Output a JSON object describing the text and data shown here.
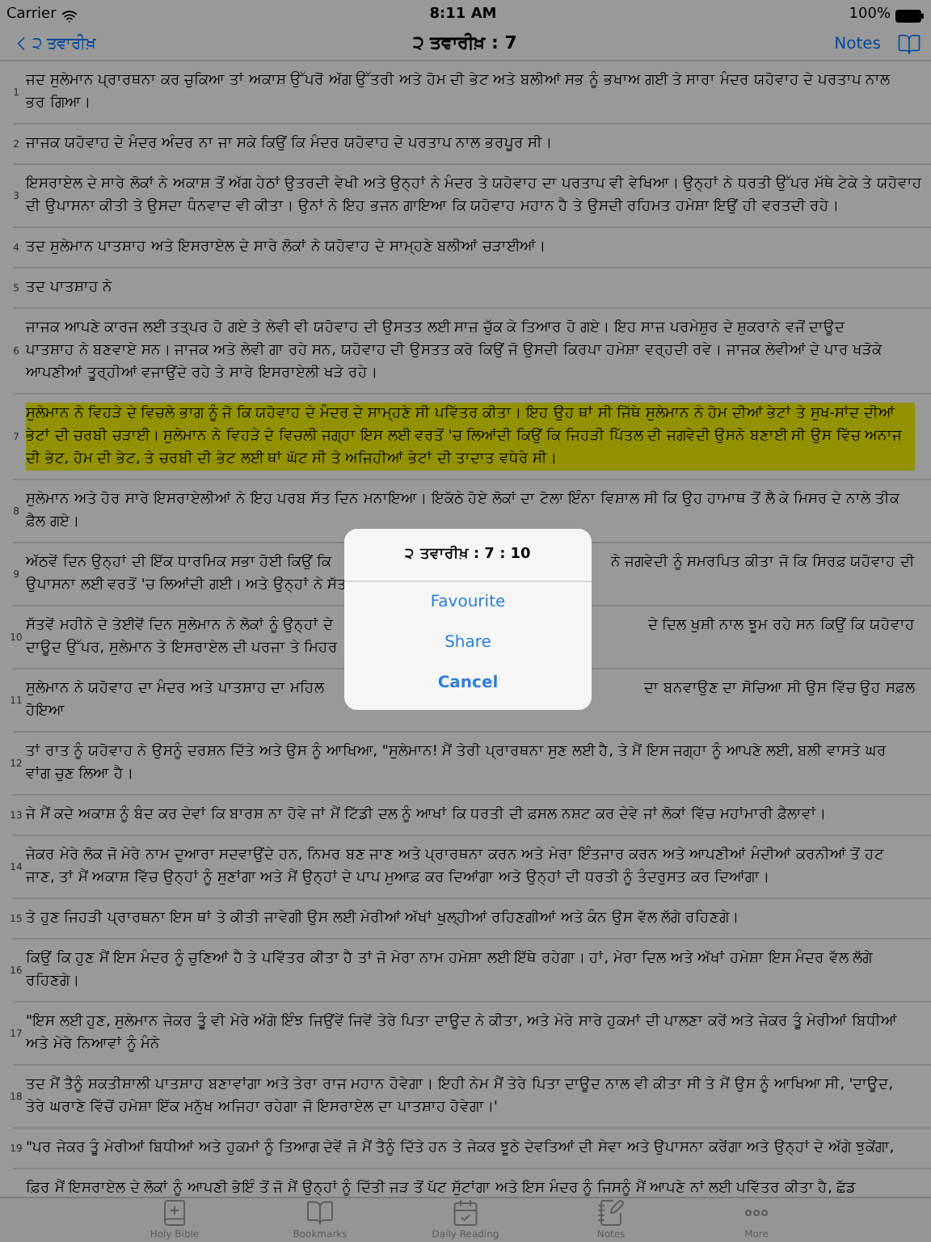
{
  "status_bar": {
    "carrier": "Carrier",
    "time": "8:11 AM",
    "battery": "100%"
  },
  "nav": {
    "back": "੨ ਤਵਾਰੀਖ਼",
    "title": "੨ ਤਵਾਰੀਖ਼ : 7",
    "notes": "Notes"
  },
  "verses": [
    {
      "number": "1",
      "highlighted": false,
      "lines": [
        [
          "ਜਦ ਸੁਲੇਮਾਨ ਪ੍ਰਾਰਥਨਾ ਕਰ ਚੁਕਿਆ ਤਾਂ ਅਕਾਸ਼ ਉੱਪਰੋਂ ਅੱਗ ਉੱਤਰੀ ਅਤੇ ਹੋਮ ਦੀ ਭੇਟ ਅਤੇ ਬਲੀਆਂ ਸਭ ਨੂੰ ਭਖਾਅ ਗਈ ਤੇ ਸਾਰਾ ਮੰਦਰ ਯਹੋਵਾਹ ਦੇ ਪਰਤਾਪ ਨਾਲ"
        ],
        [
          "ਭਰ ਗਿਆ।"
        ]
      ]
    },
    {
      "number": "2",
      "highlighted": false,
      "lines": [
        [
          "ਜਾਜਕ ਯਹੋਵਾਹ ਦੇ ਮੰਦਰ ਅੰਦਰ ਨਾ ਜਾ ਸਕੇ ਕਿਉਂ ਕਿ ਮੰਦਰ ਯਹੋਵਾਹ ਦੇ ਪਰਤਾਪ ਨਾਲ ਭਰਪੂਰ ਸੀ।"
        ]
      ]
    },
    {
      "number": "3",
      "highlighted": false,
      "lines": [
        [
          "ਇਸਰਾਏਲ ਦੇ ਸਾਰੇ ਲੋਕਾਂ ਨੇ ਅਕਾਸ਼ ਤੋਂ ਅੱਗ ਹੇਠਾਂ ਉਤਰਦੀ ਵੇਖੀ ਅਤੇ ਉਨ੍ਹਾਂ ਨੇ ਮੰਦਰ ਤੇ ਯਹੋਵਾਹ ਦਾ ਪਰਤਾਪ ਵੀ ਵੇਖਿਆ। ਉਨ੍ਹਾਂ ਨੇ ਧਰਤੀ ਉੱਪਰ ਮੱਥੇ ਟੇਕੇ ਤੇ ਯਹੋਵਾਹ"
        ],
        [
          "ਦੀ ਉਪਾਸਨਾ ਕੀਤੀ ਤੇ ਉਸਦਾ ਧੰਨਵਾਦ ਵੀ ਕੀਤਾ। ਉਨਾਂ ਨੇ ਇਹ ਭਜਨ ਗਾਇਆ ਕਿ ਯਹੋਵਾਹ ਮਹਾਨ ਹੈ ਤੇ ਉਸਦੀ ਰਹਿਮਤ ਹਮੇਸ਼ਾ ਇਉਂ ਹੀ ਵਰਤਦੀ ਰਹੇ।"
        ]
      ]
    },
    {
      "number": "4",
      "highlighted": false,
      "lines": [
        [
          "ਤਦ ਸੁਲੇਮਾਨ ਪਾਤਸ਼ਾਹ ਅਤੇ ਇਸਰਾਏਲ ਦੇ ਸਾਰੇ ਲੋਕਾਂ ਨੇ ਯਹੋਵਾਹ ਦੇ ਸਾਮ੍ਹਣੇ ਬਲੀਆਂ ਚੜਾਈਆਂ।"
        ]
      ]
    },
    {
      "number": "5",
      "highlighted": false,
      "lines": [
        [
          "ਤਦ ਪਾਤਸ਼ਾਹ ਨੇ"
        ]
      ]
    },
    {
      "number": "6",
      "highlighted": false,
      "lines": [
        [
          "ਜਾਜਕ ਆਪਣੇ ਕਾਰਜ ਲਈ ਤਤ੍ਪਰ ਹੋ ਗਏ ਤੇ ਲੇਵੀ ਵੀ ਯਹੋਵਾਹ ਦੀ ਉਸਤਤ ਲਈ ਸਾਜ਼ ਚੁੱਕ ਕੇ ਤਿਆਰ ਹੋ ਗਏ। ਇਹ ਸਾਜ਼ ਪਰਮੇਸ਼ੁਰ ਦੇ ਸ਼ੁਕਰਾਨੇ ਵਜੋਂ ਦਾਊਦ"
        ],
        [
          "ਪਾਤਸ਼ਾਹ ਨੇ ਬਣਵਾਏ ਸਨ। ਜਾਜਕ ਅਤੇ ਲੇਵੀ ਗਾ ਰਹੇ ਸਨ, ਯਹੋਵਾਹ ਦੀ ਉਸਤਤ ਕਰੋ ਕਿਉਂ ਜੋ ਉਸਦੀ ਕਿਰਪਾ ਹਮੇਸ਼ਾ ਵਰ੍ਹਦੀ ਰਵੇ। ਜਾਜਕ ਲੇਵੀਆਂ ਦੇ ਪਾਰ ਖੜੋਕੇ"
        ],
        [
          "ਆਪਣੀਆਂ ਤੂਰ੍ਹੀਆਂ ਵਜਾਉਂਦੇ ਰਹੇ ਤੇ ਸਾਰੇ ਇਸਰਾਏਲੀ ਖੜੇ ਰਹੇ।"
        ]
      ]
    },
    {
      "number": "7",
      "highlighted": true,
      "lines": [
        [
          "ਸੁਲੇਮਾਨ ਨੇ ਵਿਹੜੇ ਦੇ ਵਿਚਲੇ ਭਾਗ ਨੂੰ ਜੋ ਕਿ ਯਹੋਵਾਹ ਦੇ ਮੰਦਰ ਦੇ ਸਾਮ੍ਹਣੇ ਸੀ ਪਵਿੱਤਰ ਕੀਤਾ। ਇਹ ਉਹ ਥਾਂ ਸੀ ਜਿੱਥੇ ਸੁਲੇਮਾਨ ਨੇ ਹੋਮ ਦੀਆਂ ਭੇਟਾਂ ਤੇ ਸੁਖ-ਸਾਂਦ ਦੀਆਂ"
        ],
        [
          "ਭੇਟਾਂ ਦੀ ਚਰਬੀ ਚੜਾਈ। ਸੁਲੇਮਾਨ ਨੇ ਵਿਹੜੇ ਦੇ ਵਿਚਲੀ ਜਗ੍ਹਾ ਇਸ ਲਈ ਵਰਤੋਂ 'ਚ ਲਿਆਂਦੀ ਕਿਉਂ ਕਿ ਜਿਹੜੀ ਪਿੱਤਲ ਦੀ ਜਗਵੇਦੀ ਉਸਨੇ ਬਣਾਈ ਸੀ ਉਸ ਵਿੱਚ ਅਨਾਜ"
        ],
        [
          "ਦੀ ਭੇਟ, ਹੋਮ ਦੀ ਭੇਟ, ਤੇ ਚਰਬੀ ਦੀ ਭੇਟ ਲਈ ਥਾਂ ਘੱਟ ਸੀ ਤੇ ਅਜਿਹੀਆਂ ਭੇਟਾਂ ਦੀ ਤਾਦਾਤ ਵਧੇਰੇ ਸੀ।"
        ]
      ]
    },
    {
      "number": "8",
      "highlighted": false,
      "lines": [
        [
          "ਸੁਲੇਮਾਨ ਅਤੇ ਹੋਰ ਸਾਰੇ ਇਸਰਾਏਲੀਆਂ ਨੇ ਇਹ ਪਰਬ ਸੱਤ ਦਿਨ ਮਨਾਇਆ। ਇਕੱਠੇ ਹੋਏ ਲੋਕਾਂ ਦਾ ਟੋਲਾ ਇੰਨਾ ਵਿਸ਼ਾਲ ਸੀ ਕਿ ਉਹ ਹਾਮਾਥ ਤੋਂ ਲੈ ਕੇ ਮਿਸਰ ਦੇ ਨਾਲੇ ਤੀਕ"
        ],
        [
          "ਫ਼ੈਲ ਗਏ।"
        ]
      ]
    },
    {
      "number": "9",
      "highlighted": false,
      "lines": [
        [
          "ਅੱਠਵੇਂ ਦਿਨ ਉਨ੍ਹਾਂ ਦੀ ਇੱਕ ਧਾਰਮਿਕ ਸਭਾ ਹੋਈ ਕਿਉਂ ਕਿ",
          "ਨੇ ਜਗਵੇਦੀ ਨੂੰ ਸਮਰਪਿਤ ਕੀਤਾ ਜੋ ਕਿ ਸਿਰਫ਼ ਯਹੋਵਾਹ ਦੀ"
        ],
        [
          "ਉਪਾਸਨਾ ਲਈ ਵਰਤੋਂ 'ਚ ਲਿਆਂਦੀ ਗਈ। ਅਤੇ ਉਨ੍ਹਾਂ ਨੇ ਸੱਤ"
        ]
      ]
    },
    {
      "number": "10",
      "highlighted": false,
      "lines": [
        [
          "ਸੱਤਵੇਂ ਮਹੀਨੇ ਦੇ ਤੇਈਵੇਂ ਦਿਨ ਸੁਲੇਮਾਨ ਨੇ ਲੋਕਾਂ ਨੂੰ ਉਨ੍ਹਾਂ ਦੇ",
          "ਦੇ ਦਿਲ ਖੁਸ਼ੀ ਨਾਲ ਝੂਮ ਰਹੇ ਸਨ ਕਿਉਂ ਕਿ ਯਹੋਵਾਹ"
        ],
        [
          "ਦਾਊਦ ਉੱਪਰ, ਸੁਲੇਮਾਨ ਤੇ ਇਸਰਾਏਲ ਦੀ ਪਰਜਾ ਤੇ ਮਿਹਰ"
        ]
      ]
    },
    {
      "number": "11",
      "highlighted": false,
      "lines": [
        [
          "ਸੁਲੇਮਾਨ ਨੇ ਯਹੋਵਾਹ ਦਾ ਮੰਦਰ ਅਤੇ ਪਾਤਸ਼ਾਹ ਦਾ ਮਹਿਲ",
          "ਦਾ ਬਨਵਾਉਣ ਦਾ ਸੋਚਿਆ ਸੀ ਉਸ ਵਿੱਚ ਉਹ ਸਫ਼ਲ"
        ],
        [
          "ਹੋਇਆ"
        ]
      ]
    },
    {
      "number": "12",
      "highlighted": false,
      "lines": [
        [
          "ਤਾਂ ਰਾਤ ਨੂੰ ਯਹੋਵਾਹ ਨੇ ਉਸਨੂੰ ਦਰਸ਼ਨ ਦਿੱਤੇ ਅਤੇ ਉਸ ਨੂੰ ਆਖਿਆ, \"ਸੁਲੇਮਾਨ! ਮੈਂ ਤੇਰੀ ਪ੍ਰਾਰਥਨਾ ਸੁਣ ਲਈ ਹੈ, ਤੇ ਮੈਂ ਇਸ ਜਗ੍ਹਾ ਨੂੰ ਆਪਣੇ ਲਈ, ਬਲੀ ਵਾਸਤੇ ਘਰ"
        ],
        [
          "ਵਾਂਗ ਚੁਣ ਲਿਆ ਹੈ।"
        ]
      ]
    },
    {
      "number": "13",
      "highlighted": false,
      "lines": [
        [
          "ਜੇ ਮੈਂ ਕਦੇ ਅਕਾਸ਼ ਨੂੰ ਬੰਦ ਕਰ ਦੇਵਾਂ ਕਿ ਬਾਰਸ਼ ਨਾ ਹੋਵੇ ਜਾਂ ਮੈਂ ਟਿੱਡੀ ਦਲ ਨੂੰ ਆਖਾਂ ਕਿ ਧਰਤੀ ਦੀ ਫ਼ਸਲ ਨਸ਼ਟ ਕਰ ਦੇਵੇ ਜਾਂ ਲੋਕਾਂ ਵਿੱਚ ਮਹਾਂਮਾਰੀ ਫ਼ੈਲਾਵਾਂ।"
        ]
      ]
    },
    {
      "number": "14",
      "highlighted": false,
      "lines": [
        [
          "ਜੇਕਰ ਮੇਰੇ ਲੋਕ ਜੋ ਮੇਰੇ ਨਾਮ ਦੁਆਰਾ ਸਦਵਾਉਂਦੇ ਹਨ, ਨਿਮਰ ਬਣ ਜਾਣ ਅਤੇ ਪ੍ਰਾਰਥਨਾ ਕਰਨ ਅਤੇ ਮੇਰਾ ਇੰਤਜਾਰ ਕਰਨ ਅਤੇ ਆਪਣੀਆਂ ਮੰਦੀਆਂ ਕਰਨੀਆਂ ਤੋਂ ਹਟ"
        ],
        [
          "ਜਾਣ, ਤਾਂ ਮੈਂ ਅਕਾਸ਼ ਵਿੱਚ ਉਨ੍ਹਾਂ ਨੂੰ ਸੁਣਾਂਗਾ ਅਤੇ ਮੈਂ ਉਨ੍ਹਾਂ ਦੇ ਪਾਪ ਮੁਆਫ਼ ਕਰ ਦਿਆਂਗਾ ਅਤੇ ਉਨ੍ਹਾਂ ਦੀ ਧਰਤੀ ਨੂੰ ਤੰਦਰੁਸਤ ਕਰ ਦਿਆਂਗਾ।"
        ]
      ]
    },
    {
      "number": "15",
      "highlighted": false,
      "lines": [
        [
          "ਤੇ ਹੁਣ ਜਿਹੜੀ ਪ੍ਰਾਰਥਨਾ ਇਸ ਥਾਂ ਤੇ ਕੀਤੀ ਜਾਵੇਗੀ ਉਸ ਲਈ ਮੇਰੀਆਂ ਅੱਖਾਂ ਖੁਲ੍ਹੀਆਂ ਰਹਿਣਗੀਆਂ ਅਤੇ ਕੰਨ ਉਸ ਵੱਲ ਲੱਗੇ ਰਹਿਣਗੇ।"
        ]
      ]
    },
    {
      "number": "16",
      "highlighted": false,
      "lines": [
        [
          "ਕਿਉਂ ਕਿ ਹੁਣ ਮੈਂ ਇਸ ਮੰਦਰ ਨੂੰ ਚੁਣਿਆਂ ਹੈ ਤੇ ਪਵਿੱਤਰ ਕੀਤਾ ਹੈ ਤਾਂ ਜੋ ਮੇਰਾ ਨਾਮ ਹਮੇਸ਼ਾ ਲਈ ਇੱਥੇ ਰਹੇਗਾ। ਹਾਂ, ਮੇਰਾ ਦਿਲ ਅਤੇ ਅੱਖਾਂ ਹਮੇਸ਼ਾ ਇਸ ਮੰਦਰ ਵੱਲ ਲੱਗੇ"
        ],
        [
          "ਰਹਿਣਗੇ।"
        ]
      ]
    },
    {
      "number": "17",
      "highlighted": false,
      "lines": [
        [
          "\"ਇਸ ਲਈ ਹੁਣ, ਸੁਲੇਮਾਨ ਜੇਕਰ ਤੂੰ ਵੀ ਮੇਰੇ ਅੱਗੇ ਇੰਝ ਜਿਉਂਵੇਂ ਜਿਵੇਂ ਤੇਰੇ ਪਿਤਾ ਦਾਊਦ ਨੇ ਕੀਤਾ, ਅਤੇ ਮੇਰੇ ਸਾਰੇ ਹੁਕਮਾਂ ਦੀ ਪਾਲਣਾ ਕਰੇਂ ਅਤੇ ਜੇਕਰ ਤੂੰ ਮੇਰੀਆਂ ਬਿਧੀਆਂ"
        ],
        [
          "ਅਤੇ ਮੇਰੇ ਨਿਆਵਾਂ ਨੂੰ ਮੰਨੇ"
        ]
      ]
    },
    {
      "number": "18",
      "highlighted": false,
      "lines": [
        [
          "ਤਦ ਮੈਂ ਤੈਨੂੰ ਸ਼ਕਤੀਸ਼ਾਲੀ ਪਾਤਸ਼ਾਹ ਬਣਾਵਾਂਗਾ ਅਤੇ ਤੇਰਾ ਰਾਜ ਮਹਾਨ ਹੋਵੇਗਾ। ਇਹੀ ਨੇਮ ਮੈਂ ਤੇਰੇ ਪਿਤਾ ਦਾਊਦ ਨਾਲ ਵੀ ਕੀਤਾ ਸੀ ਤੇ ਮੈਂ ਉਸ ਨੂੰ ਆਖਿਆ ਸੀ, 'ਦਾਊਦ,"
        ],
        [
          "ਤੇਰੇ ਘਰਾਣੇ ਵਿੱਚੋਂ ਹਮੇਸ਼ਾ ਇੱਕ ਮਨੁੱਖ ਅਜਿਹਾ ਰਹੇਗਾ ਜੋ ਇਸਰਾਏਲ ਦਾ ਪਾਤਸ਼ਾਹ ਹੋਵੇਗਾ।'"
        ]
      ]
    },
    {
      "number": "19",
      "highlighted": false,
      "lines": [
        [
          "\"ਪਰ ਜੇਕਰ ਤੂੰ ਮੇਰੀਆਂ ਬਿਧੀਆਂ ਅਤੇ ਹੁਕਮਾਂ ਨੂੰ ਤਿਆਗ ਦੇਵੇਂ ਜੋ ਮੈਂ ਤੈਨੂੰ ਦਿੱਤੇ ਹਨ ਤੇ ਜੇਕਰ ਝੂਠੇ ਦੇਵਤਿਆਂ ਦੀ ਸੇਵਾ ਅਤੇ ਉਪਾਸਨਾ ਕਰੇਂਗਾ ਅਤੇ ਉਨ੍ਹਾਂ ਦੇ ਅੱਗੇ ਝੁਕੇਂਗਾ,"
        ]
      ]
    },
    {
      "highlighted": false,
      "lines": [
        [
          "ਫ਼ਿਰ ਮੈਂ ਇਸਰਾਏਲ ਦੇ ਲੋਕਾਂ ਨੂੰ ਆਪਣੀ ਭੋਇੰ ਤੋਂ ਜੋ ਮੈਂ ਉਨ੍ਹਾਂ ਨੂੰ ਦਿੱਤੀ ਜੜ ਤੋਂ ਪੱਟ ਸੁੱਟਾਂਗਾ ਅਤੇ ਇਸ ਮੰਦਰ ਨੂੰ ਜਿਸਨੂੰ ਮੈਂ ਆਪਣੇ ਨਾਂ ਲਈ ਪਵਿੱਤਰ ਕੀਤਾ ਹੈ, ਛੱਡ"
        ]
      ]
    }
  ],
  "tab_bar": [
    {
      "kind": "bible",
      "label": "Holy Bible"
    },
    {
      "kind": "bookmarks",
      "label": "Bookmarks"
    },
    {
      "kind": "daily",
      "label": "Daily Reading"
    },
    {
      "kind": "notes",
      "label": "Notes"
    },
    {
      "kind": "more",
      "label": "More"
    }
  ],
  "dialog": {
    "title": "੨ ਤਵਾਰੀਖ਼ : 7 : 10",
    "actions": [
      {
        "label": "Favourite",
        "bold": false
      },
      {
        "label": "Share",
        "bold": false
      },
      {
        "label": "Cancel",
        "bold": true
      }
    ]
  }
}
